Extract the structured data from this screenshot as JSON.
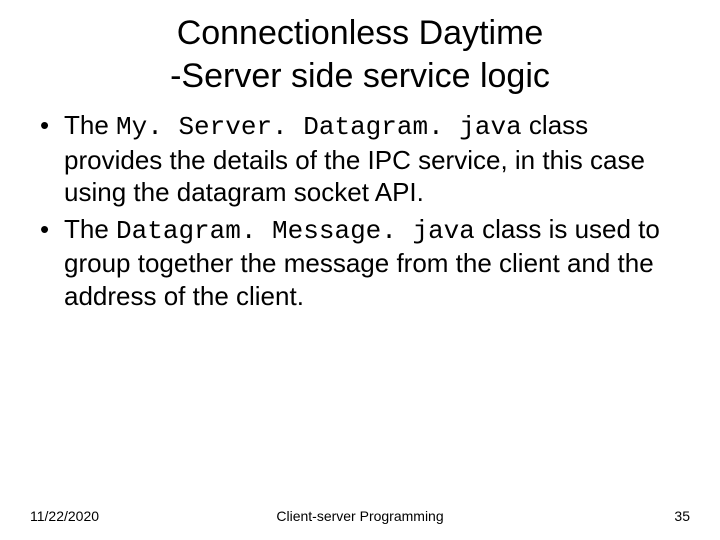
{
  "title": {
    "line1": "Connectionless Daytime",
    "line2": "-Server side service logic"
  },
  "bullets": [
    {
      "pre": "The ",
      "code": "My. Server. Datagram. java",
      "post": " class provides the details of the IPC service, in this case using the datagram socket API."
    },
    {
      "pre": "The ",
      "code": "Datagram. Message. java",
      "post": " class is used to group together the message from the client and the address of the client."
    }
  ],
  "footer": {
    "date": "11/22/2020",
    "center": "Client-server Programming",
    "page": "35"
  }
}
